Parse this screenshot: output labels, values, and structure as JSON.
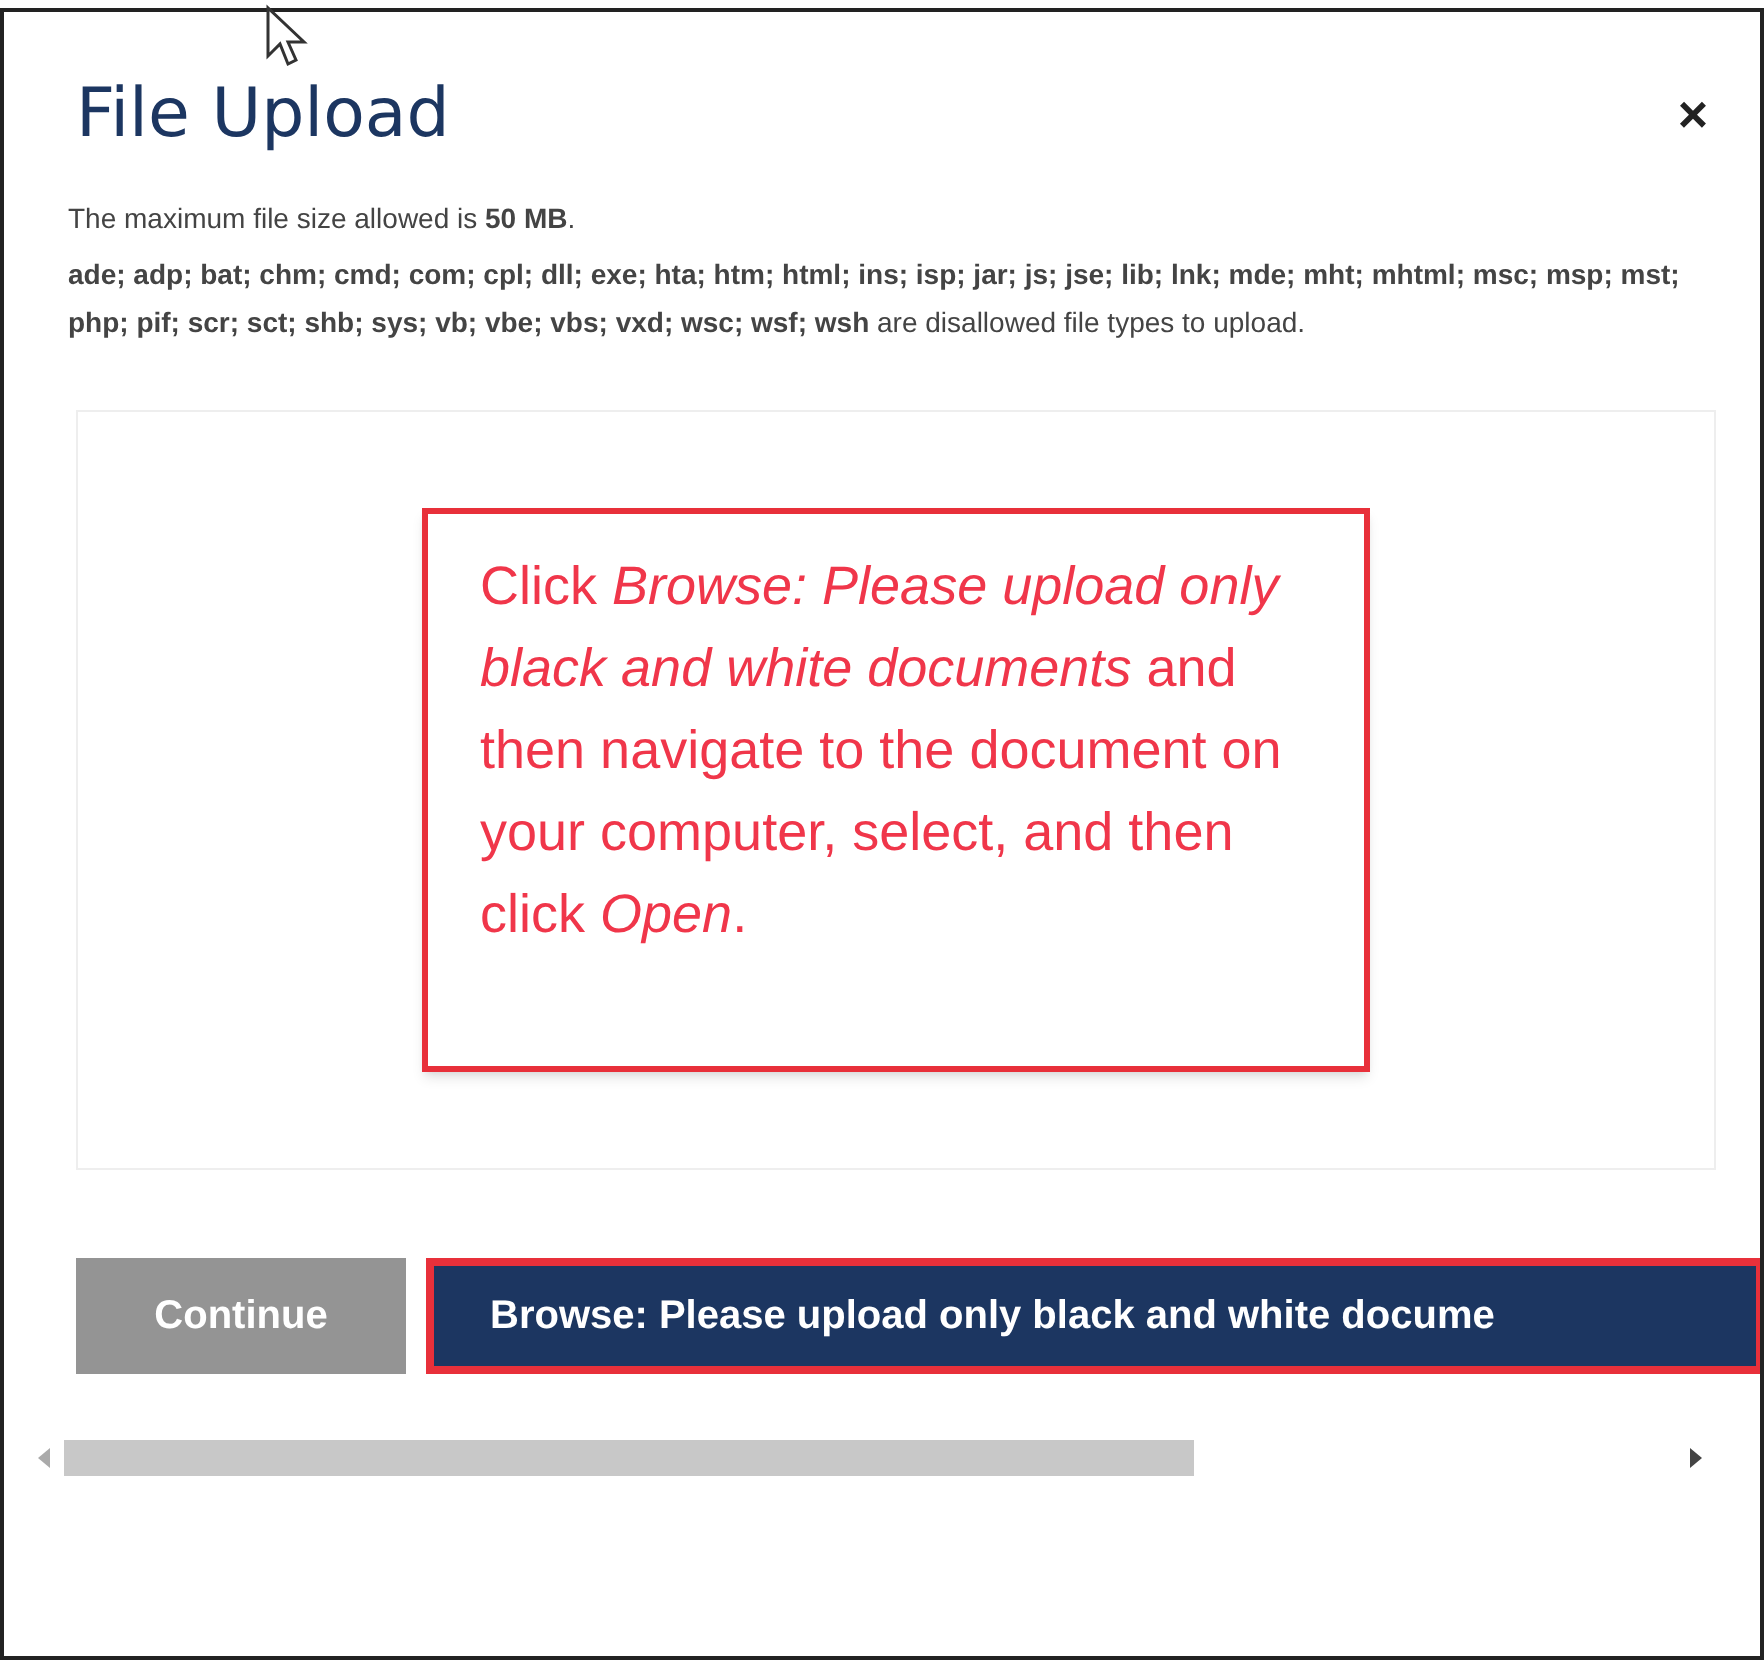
{
  "dialog": {
    "title": "File Upload",
    "close": "×"
  },
  "info": [
    "The maximum file size allowed is **50 MB**.",
    "**ade; adp; bat; chm; cmd; com; cpl; dll; exe; hta; htm; html; ins; isp; jar; js; jse; lib; lnk; mde; mht; mhtml; msc; msp; mst; php; pif; scr; sct; shb; sys; vb; vbe; vbs; vxd; wsc; wsf; wsh** are disallowed file types to upload."
  ],
  "callout": "Click *Browse: Please upload only black and white documents* and then navigate to the document on your computer, select, and then click *Open*.",
  "buttons": [
    {
      "kind": "secondary",
      "label": "Continue",
      "disabled": true
    },
    {
      "kind": "primary",
      "label": "Browse: Please upload only black and white docume",
      "disabled": false,
      "highlighted": true
    }
  ]
}
